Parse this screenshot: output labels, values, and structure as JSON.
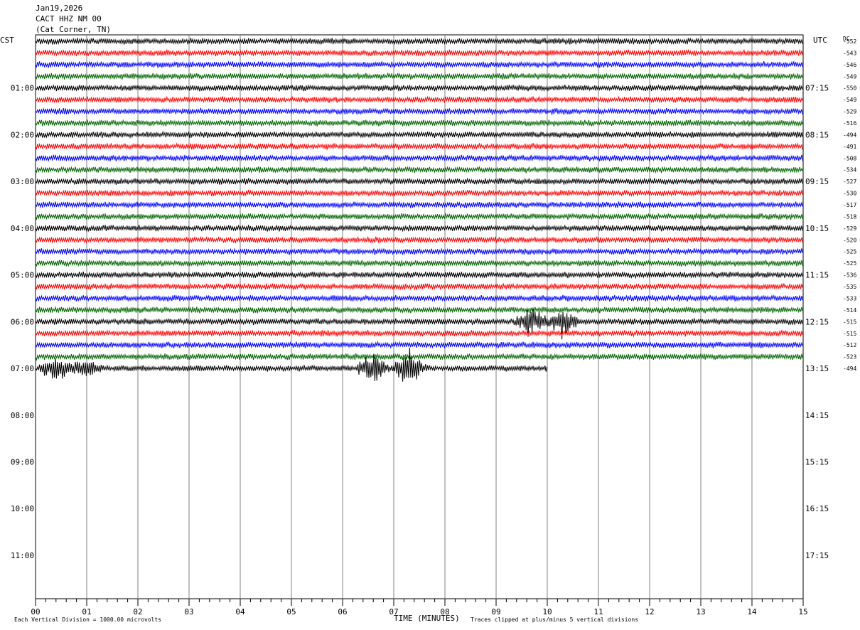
{
  "header": {
    "date": "Jan19,2026",
    "station": "CACT HHZ NM 00",
    "location": "(Cat Corner, TN)"
  },
  "left_zone": "CST",
  "right_zone": "UTC",
  "dc_label": "DC",
  "footer": {
    "logo": "",
    "scale_note": "Each Vertical Division = 1000.00 microvolts",
    "clip_note": "Traces clipped at plus/minus 5 vertical divisions"
  },
  "colors": {
    "c0": "#000000",
    "c1": "#ff0000",
    "c2": "#0000ff",
    "c3": "#006400"
  },
  "chart_data": {
    "type": "line",
    "title": "CACT HHZ NM 00",
    "xlabel": "TIME (MINUTES)",
    "ylabel": "",
    "xlim": [
      0,
      15
    ],
    "x_ticks": [
      "00",
      "01",
      "02",
      "03",
      "04",
      "05",
      "06",
      "07",
      "08",
      "09",
      "10",
      "11",
      "12",
      "13",
      "14",
      "15"
    ],
    "hour_labels_cst": [
      "01:00",
      "02:00",
      "03:00",
      "04:00",
      "05:00",
      "06:00",
      "07:00",
      "08:00",
      "09:00",
      "10:00",
      "11:00"
    ],
    "hour_labels_utc": [
      "07:15",
      "08:15",
      "09:15",
      "10:15",
      "11:15",
      "12:15",
      "13:15",
      "14:15",
      "15:15",
      "16:15",
      "17:15"
    ],
    "trace_colors": [
      "#000000",
      "#ff0000",
      "#0000ff",
      "#006400"
    ],
    "trace_count": 29,
    "last_trace_end_minute": 10.0,
    "dc_offsets": [
      "-552",
      "-543",
      "-546",
      "-549",
      "-550",
      "-549",
      "-529",
      "-516",
      "-494",
      "-491",
      "-508",
      "-534",
      "-527",
      "-530",
      "-517",
      "-518",
      "-529",
      "-520",
      "-525",
      "-525",
      "-536",
      "-535",
      "-533",
      "-514",
      "-515",
      "-515",
      "-512",
      "-523",
      "-494"
    ],
    "events": [
      {
        "trace": 24,
        "minute": 9.7,
        "amplitude": 3.0
      },
      {
        "trace": 24,
        "minute": 10.3,
        "amplitude": 3.0
      },
      {
        "trace": 28,
        "minute": 0.4,
        "amplitude": 2.5
      },
      {
        "trace": 28,
        "minute": 1.0,
        "amplitude": 2.2
      },
      {
        "trace": 28,
        "minute": 6.6,
        "amplitude": 3.5
      },
      {
        "trace": 28,
        "minute": 7.3,
        "amplitude": 4.0
      }
    ]
  }
}
